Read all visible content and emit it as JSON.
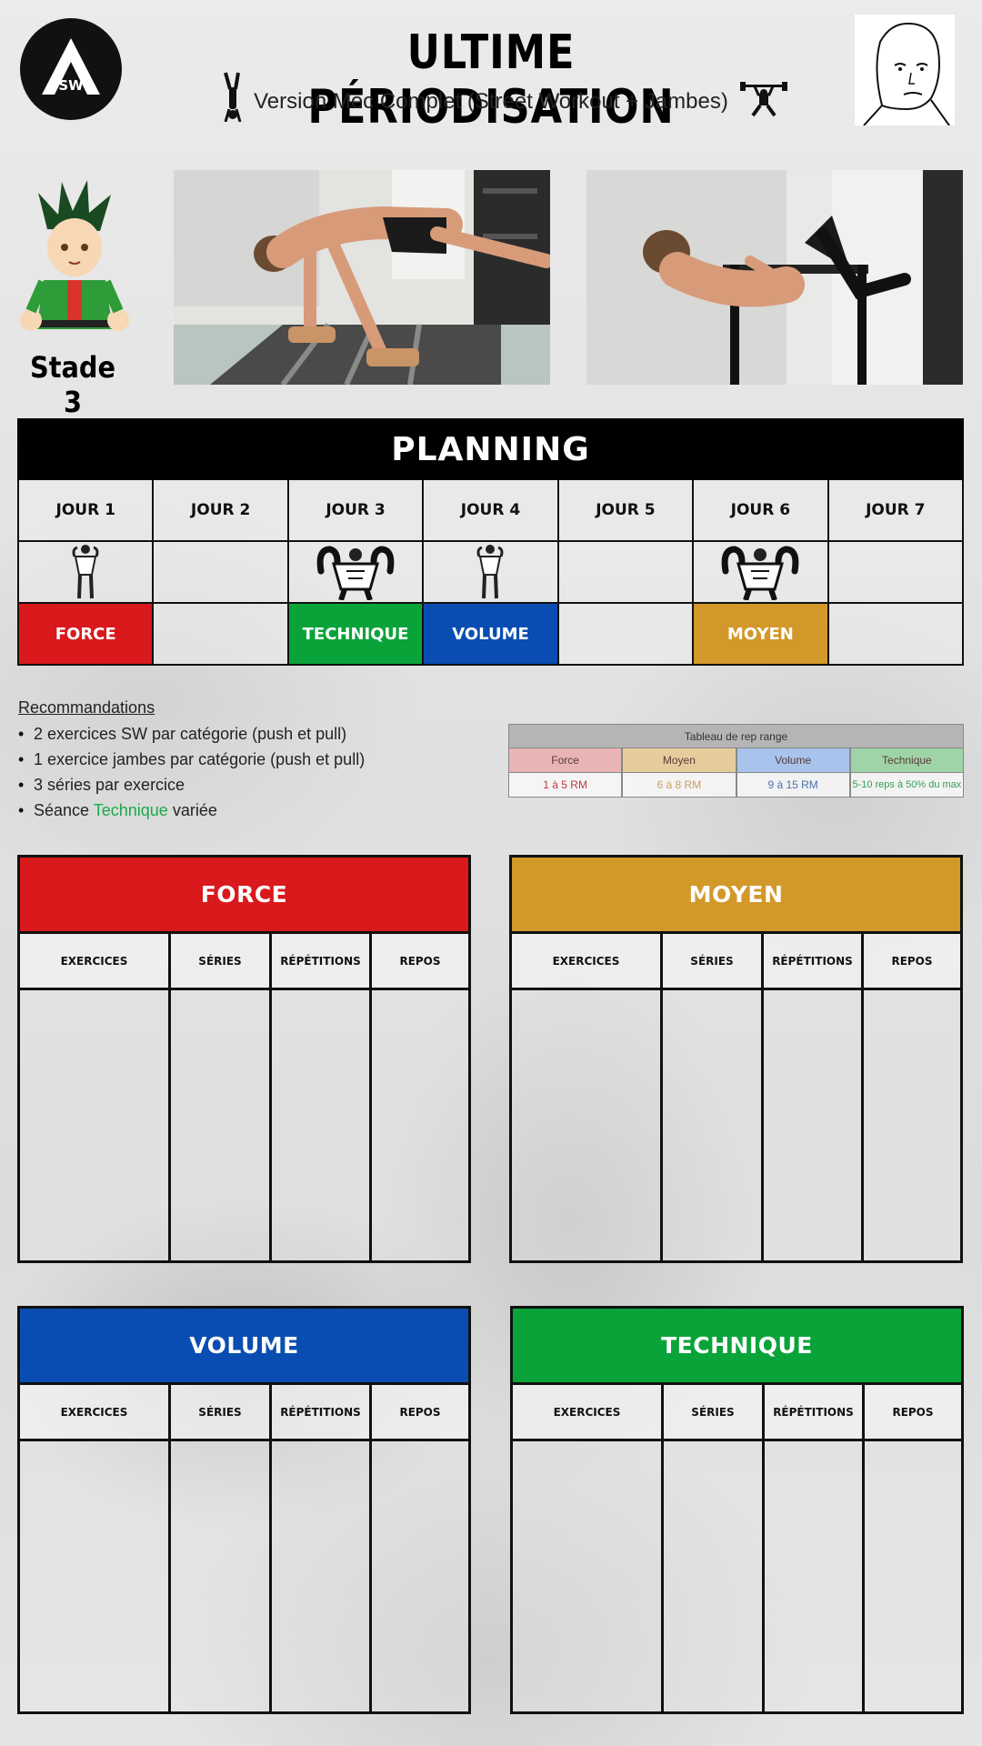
{
  "header": {
    "logo_text": "SW",
    "title": "ULTIME PÉRIODISATION",
    "subtitle": "Version Mec Complet (Street Workout + Jambes)"
  },
  "stage": {
    "label": "Stade 3"
  },
  "planning": {
    "title": "PLANNING",
    "days": [
      "JOUR 1",
      "JOUR 2",
      "JOUR 3",
      "JOUR 4",
      "JOUR 5",
      "JOUR 6",
      "JOUR 7"
    ],
    "sessions": [
      "FORCE",
      "",
      "TECHNIQUE",
      "VOLUME",
      "",
      "MOYEN",
      ""
    ],
    "session_colors": [
      "#d9191c",
      "",
      "#0aa33a",
      "#0a4db2",
      "",
      "#d2982a",
      ""
    ],
    "figures": [
      "slim",
      "",
      "muscular",
      "slim",
      "",
      "muscular",
      ""
    ]
  },
  "recommendations": {
    "title": "Recommandations",
    "items": [
      {
        "text": "2 exercices SW par catégorie (push et pull)"
      },
      {
        "text": "1 exercice jambes par catégorie (push et pull)"
      },
      {
        "text": "3 séries par exercice"
      },
      {
        "text_before": "Séance ",
        "highlight": "Technique",
        "text_after": " variée"
      }
    ],
    "highlight_color": "#1ba84a"
  },
  "rep_range": {
    "title": "Tableau de rep range",
    "columns": [
      {
        "label": "Force",
        "value": "1 à 5 RM",
        "bg": "#e8b4b6",
        "color": "#c0393d"
      },
      {
        "label": "Moyen",
        "value": "6 à 8 RM",
        "bg": "#e6cc9c",
        "color": "#caa060"
      },
      {
        "label": "Volume",
        "value": "9 à 15 RM",
        "bg": "#a8c4ec",
        "color": "#4a72a8"
      },
      {
        "label": "Technique",
        "value": "5-10 reps à 50% du max",
        "bg": "#9fd4a8",
        "color": "#33a050"
      }
    ]
  },
  "tables": {
    "headers": [
      "EXERCICES",
      "SÉRIES",
      "RÉPÉTITIONS",
      "REPOS"
    ],
    "force": {
      "title": "FORCE",
      "color": "#d9191c"
    },
    "moyen": {
      "title": "MOYEN",
      "color": "#d2982a"
    },
    "volume": {
      "title": "VOLUME",
      "color": "#0a4db2"
    },
    "technique": {
      "title": "TECHNIQUE",
      "color": "#0aa33a"
    }
  }
}
